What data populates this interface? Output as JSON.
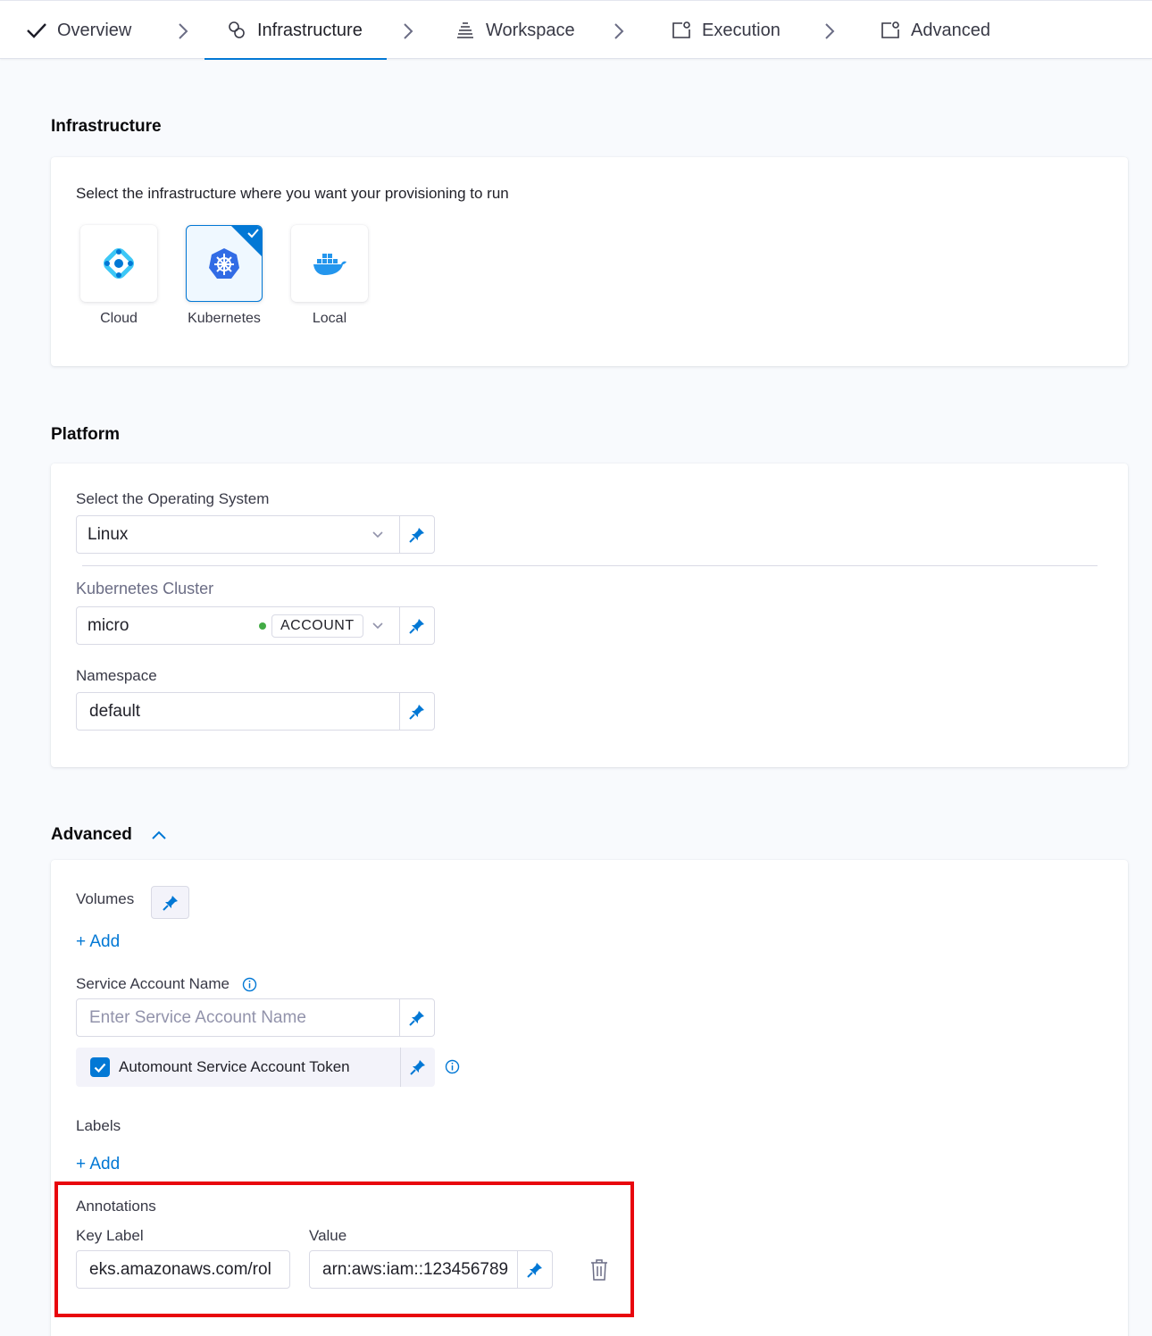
{
  "stepper": {
    "steps": [
      {
        "label": "Overview",
        "icon": "checkmark-icon",
        "state": "completed"
      },
      {
        "label": "Infrastructure",
        "icon": "infrastructure-icon",
        "state": "active"
      },
      {
        "label": "Workspace",
        "icon": "workspace-icon",
        "state": "pending"
      },
      {
        "label": "Execution",
        "icon": "execution-icon",
        "state": "pending"
      },
      {
        "label": "Advanced",
        "icon": "advanced-icon",
        "state": "pending"
      }
    ]
  },
  "infrastructure": {
    "title": "Infrastructure",
    "prompt": "Select the infrastructure where you want your provisioning to run",
    "options": [
      {
        "label": "Cloud",
        "icon": "harness-cloud-icon",
        "selected": false
      },
      {
        "label": "Kubernetes",
        "icon": "kubernetes-icon",
        "selected": true
      },
      {
        "label": "Local",
        "icon": "docker-icon",
        "selected": false
      }
    ]
  },
  "platform": {
    "title": "Platform",
    "os_label": "Select the Operating System",
    "os_value": "Linux",
    "cluster_label": "Kubernetes Cluster",
    "cluster_value": "micro",
    "cluster_scope": "ACCOUNT",
    "namespace_label": "Namespace",
    "namespace_value": "default"
  },
  "advanced": {
    "title": "Advanced",
    "volumes_label": "Volumes",
    "add_label": "+ Add",
    "service_account_label": "Service Account Name",
    "service_account_placeholder": "Enter Service Account Name",
    "automount_label": "Automount Service Account Token",
    "automount_checked": true,
    "labels_label": "Labels",
    "annotations_label": "Annotations",
    "key_label": "Key Label",
    "value_label": "Value",
    "annotation_key": "eks.amazonaws.com/rol",
    "annotation_value": "arn:aws:iam::123456789"
  },
  "colors": {
    "accent": "#0278d5",
    "highlight": "#e8060d",
    "background": "#f8fafd"
  }
}
